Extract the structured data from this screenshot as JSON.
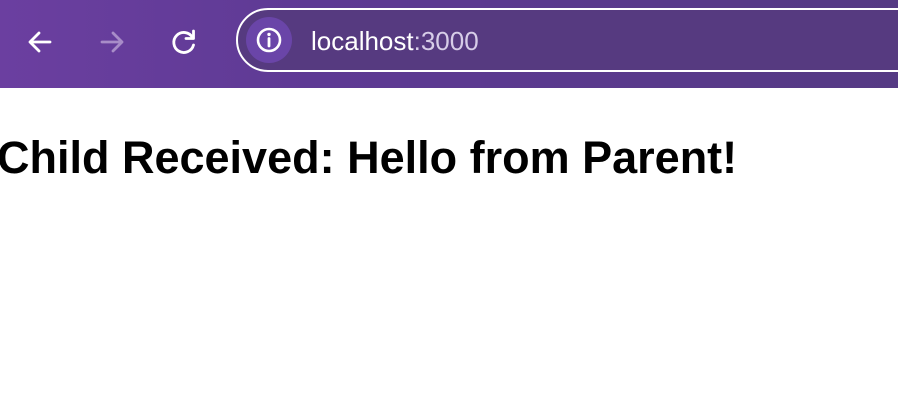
{
  "browser": {
    "nav": {
      "back_icon": "arrow-left-icon",
      "forward_icon": "arrow-right-icon",
      "reload_icon": "reload-icon",
      "forward_disabled": true
    },
    "address_bar": {
      "site_info_icon": "info-icon",
      "host": "localhost",
      "port": ":3000"
    },
    "colors": {
      "toolbar": "#5e3a94",
      "omnibox": "#563a80",
      "site_info_bg": "#6a45a8"
    }
  },
  "page": {
    "heading": "Child Received: Hello from Parent!"
  }
}
